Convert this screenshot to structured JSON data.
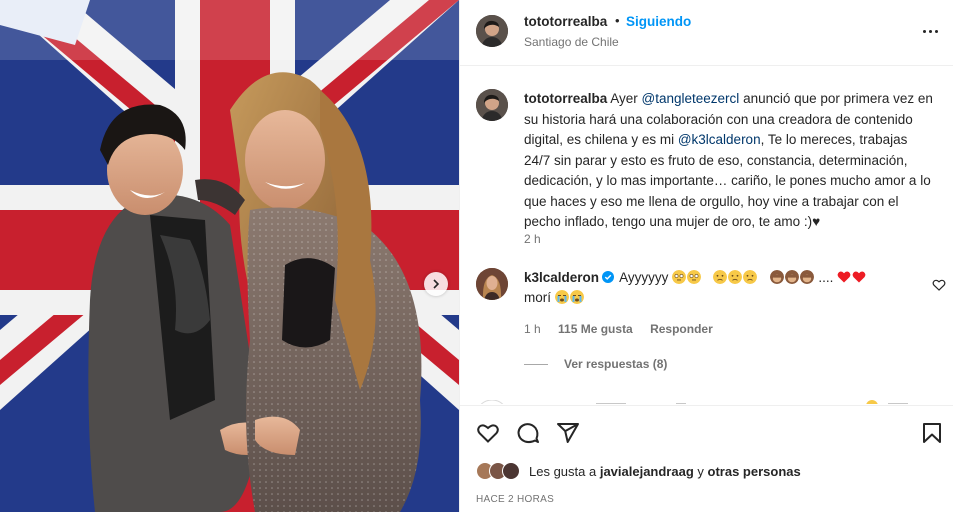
{
  "header": {
    "username": "tototorrealba",
    "separator": "•",
    "follow_label": "Siguiendo",
    "location": "Santiago de Chile",
    "more_label": "More options"
  },
  "caption": {
    "username": "tototorrealba",
    "text_1": "Ayer ",
    "mention_1": "@tangleteezercl",
    "text_2": " anunció que por primera vez en su historia hará una colaboración con una creadora de contenido digital, es chilena y es mi ",
    "mention_2": "@k3lcalderon",
    "text_3": ", Te lo mereces, trabajas 24/7 sin parar y esto es fruto de eso, constancia, determinación, dedicación, y lo mas importante… cariño, le pones mucho amor a lo que haces y eso me llena de orgullo, hoy vine a trabajar con el pecho inflado, tengo una mujer de oro, te amo :)♥",
    "time": "2 h"
  },
  "comment": {
    "username": "k3lcalderon",
    "text_1": "Ayyyyyy",
    "dots": "....",
    "text_2": "morí",
    "time": "1 h",
    "likes": "115 Me gusta",
    "reply_label": "Responder",
    "view_replies": "Ver respuestas (8)"
  },
  "actions": {
    "like_icon": "heart-icon",
    "comment_icon": "comment-icon",
    "share_icon": "send-icon",
    "save_icon": "bookmark-icon"
  },
  "likes": {
    "prefix": "Les gusta a ",
    "user": "javialejandraag",
    "middle": " y ",
    "others": "otras personas"
  },
  "posted": "HACE 2 HORAS",
  "colors": {
    "accent": "#0095f6",
    "mention": "#00376b",
    "muted": "#737373",
    "heart_red": "#ed1c24",
    "verified": "#0095f6"
  }
}
